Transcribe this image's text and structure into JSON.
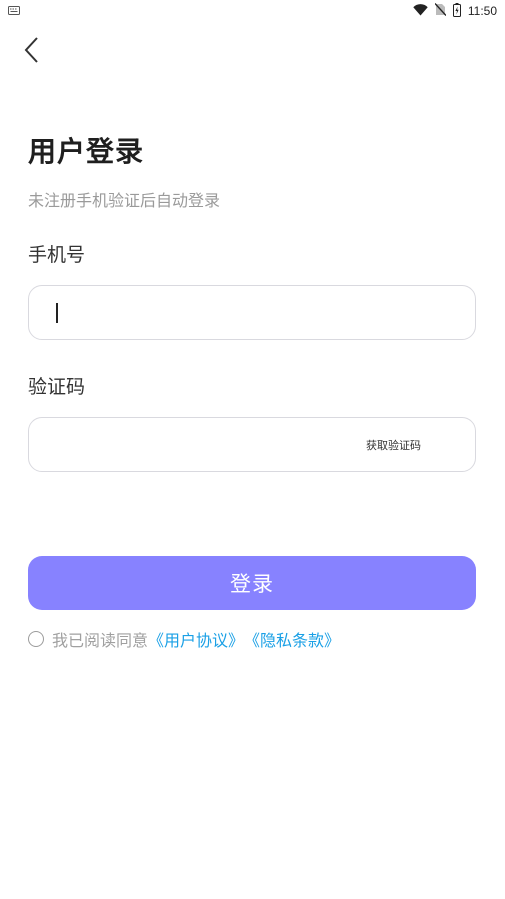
{
  "status_bar": {
    "time": "11:50",
    "icons": [
      "keyboard-icon",
      "wifi-icon",
      "no-sim-icon",
      "battery-icon"
    ]
  },
  "nav": {
    "back_icon": "chevron-left-icon"
  },
  "login": {
    "title": "用户登录",
    "subtitle": "未注册手机验证后自动登录",
    "phone_label": "手机号",
    "phone_value": "",
    "code_label": "验证码",
    "code_value": "",
    "get_code": "获取验证码",
    "submit": "登录"
  },
  "agreement": {
    "prefix": "我已阅读同意",
    "user_agreement": "《用户协议》",
    "privacy_policy": "《隐私条款》",
    "checked": false
  },
  "colors": {
    "primary": "#8782ff",
    "link": "#1aa0e6",
    "muted_text": "#9a9a9a",
    "border": "#d9d9df"
  }
}
